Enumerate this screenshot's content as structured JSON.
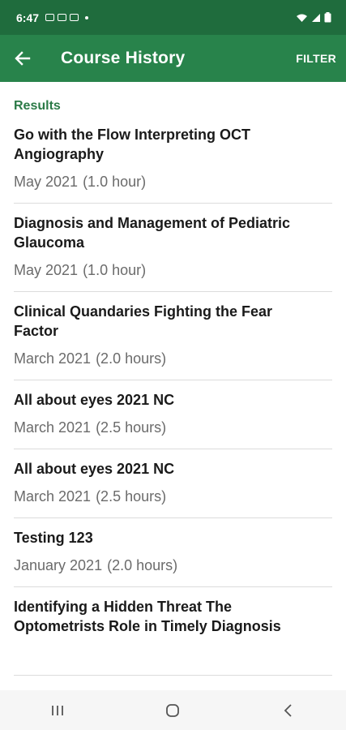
{
  "status_bar": {
    "time": "6:47"
  },
  "app_bar": {
    "title": "Course History",
    "filter_label": "FILTER"
  },
  "results_label": "Results",
  "courses": [
    {
      "title": "Go with the Flow Interpreting OCT Angiography",
      "date": "May 2021",
      "duration": "(1.0 hour)"
    },
    {
      "title": "Diagnosis and Management of Pediatric Glaucoma",
      "date": "May 2021",
      "duration": "(1.0 hour)"
    },
    {
      "title": "Clinical Quandaries Fighting the Fear Factor",
      "date": "March 2021",
      "duration": "(2.0 hours)"
    },
    {
      "title": "All about eyes 2021 NC",
      "date": "March 2021",
      "duration": "(2.5 hours)"
    },
    {
      "title": "All about eyes 2021 NC",
      "date": "March 2021",
      "duration": "(2.5 hours)"
    },
    {
      "title": "Testing 123",
      "date": "January 2021",
      "duration": "(2.0 hours)"
    },
    {
      "title": "Identifying a Hidden Threat The Optometrists Role in Timely Diagnosis",
      "date": "",
      "duration": ""
    }
  ],
  "colors": {
    "status_bar": "#1f6c3d",
    "app_bar": "#28834b",
    "accent_text": "#2b7a47"
  },
  "icons": {
    "back": "arrow-left-icon",
    "recents": "recents-icon",
    "home": "home-icon",
    "nav_back": "chevron-left-icon"
  }
}
